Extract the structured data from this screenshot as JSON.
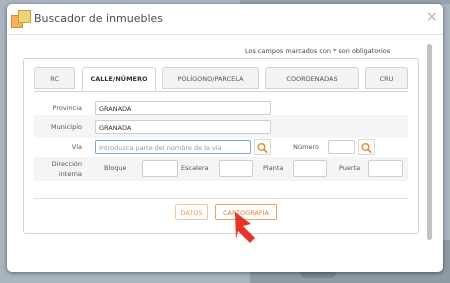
{
  "dialog": {
    "title": "Buscador de inmuebles",
    "close_symbol": "×"
  },
  "required_note": "Los campos marcados con * son obligatorios",
  "tabs": [
    {
      "label": "RC",
      "active": false
    },
    {
      "label": "CALLE/NÚMERO",
      "active": true
    },
    {
      "label": "POLÍGONO/PARCELA",
      "active": false
    },
    {
      "label": "COORDENADAS",
      "active": false
    },
    {
      "label": "CRU",
      "active": false
    }
  ],
  "form": {
    "provincia_label": "Provincia",
    "provincia_value": "GRANADA",
    "municipio_label": "Municipio",
    "municipio_value": "GRANADA",
    "via_label": "Vía",
    "via_placeholder": "Introduzca parte del nombre de la vía",
    "numero_label": "Número",
    "numero_value": "",
    "direccion_label_1": "Dirección",
    "direccion_label_2": "interna",
    "bloque_label": "Bloque",
    "escalera_label": "Escalera",
    "planta_label": "Planta",
    "puerta_label": "Puerta"
  },
  "buttons": {
    "datos": "DATOS",
    "cartografia": "CARTOGRAFÍA"
  },
  "colors": {
    "accent": "#e07f2f",
    "arrow": "#e8332a",
    "search_icon": "#e98a2c"
  },
  "icons": [
    "logo-icon",
    "close-icon",
    "search-icon",
    "arrow-pointer-icon"
  ]
}
